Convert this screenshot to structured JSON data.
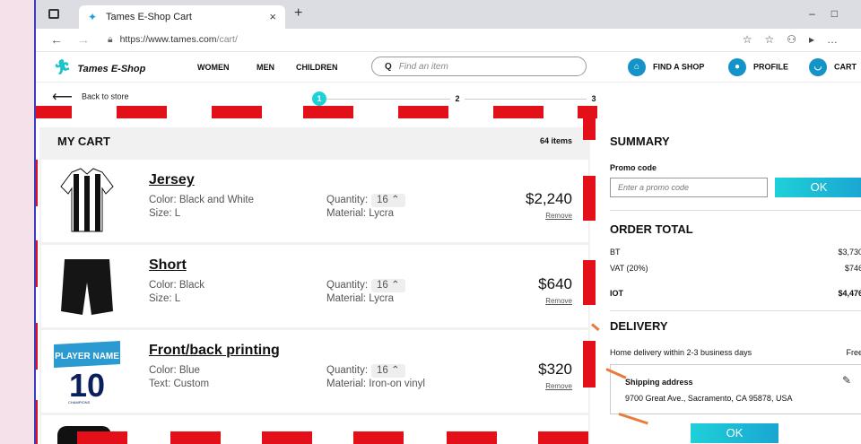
{
  "browser": {
    "tab_title": "Tames E-Shop Cart",
    "url_host": "https://www.tames.com",
    "url_path": "/cart/"
  },
  "site": {
    "logo": "Tames E-Shop",
    "nav": [
      "WOMEN",
      "MEN",
      "CHILDREN"
    ],
    "search_placeholder": "Find an item",
    "find_shop": "FIND A SHOP",
    "profile": "PROFILE",
    "cart": "CART"
  },
  "checkout": {
    "back_label": "Back to store",
    "steps": [
      "1",
      "2",
      "3"
    ],
    "active_step": 1
  },
  "cart": {
    "title": "MY CART",
    "count": "64 items",
    "quantity_label": "Quantity:",
    "remove_label": "Remove",
    "items": [
      {
        "name": "Jersey",
        "detail1": "Color: Black and White",
        "detail2": "Size: L",
        "qty": "16",
        "material": "Material: Lycra",
        "price": "$2,240"
      },
      {
        "name": "Short",
        "detail1": "Color: Black",
        "detail2": "Size: L",
        "qty": "16",
        "material": "Material: Lycra",
        "price": "$640"
      },
      {
        "name": "Front/back printing",
        "detail1": "Color: Blue",
        "detail2": "Text: Custom",
        "qty": "16",
        "material": "Material: Iron-on vinyl",
        "price": "$320"
      }
    ],
    "print_preview": {
      "player": "PLAYER NAME",
      "number": "10",
      "tag": "CHAMPIONS"
    }
  },
  "summary": {
    "title": "SUMMARY",
    "promo_label": "Promo code",
    "promo_placeholder": "Enter a promo code",
    "promo_ok": "OK",
    "order_total_title": "ORDER TOTAL",
    "bt_label": "BT",
    "bt_value": "$3,730",
    "vat_label": "VAT (20%)",
    "vat_value": "$746",
    "iot_label": "IOT",
    "iot_value": "$4,476",
    "delivery_title": "DELIVERY",
    "delivery_text": "Home delivery within 2-3 business days",
    "delivery_cost": "Free",
    "shipping_title": "Shipping address",
    "shipping_address": "9700 Great Ave., Sacramento, CA 95878, USA",
    "ok": "OK"
  },
  "colors": {
    "accent": "#1ec4c9",
    "brand_blue": "#1493c8",
    "highlight": "#e3101a"
  }
}
